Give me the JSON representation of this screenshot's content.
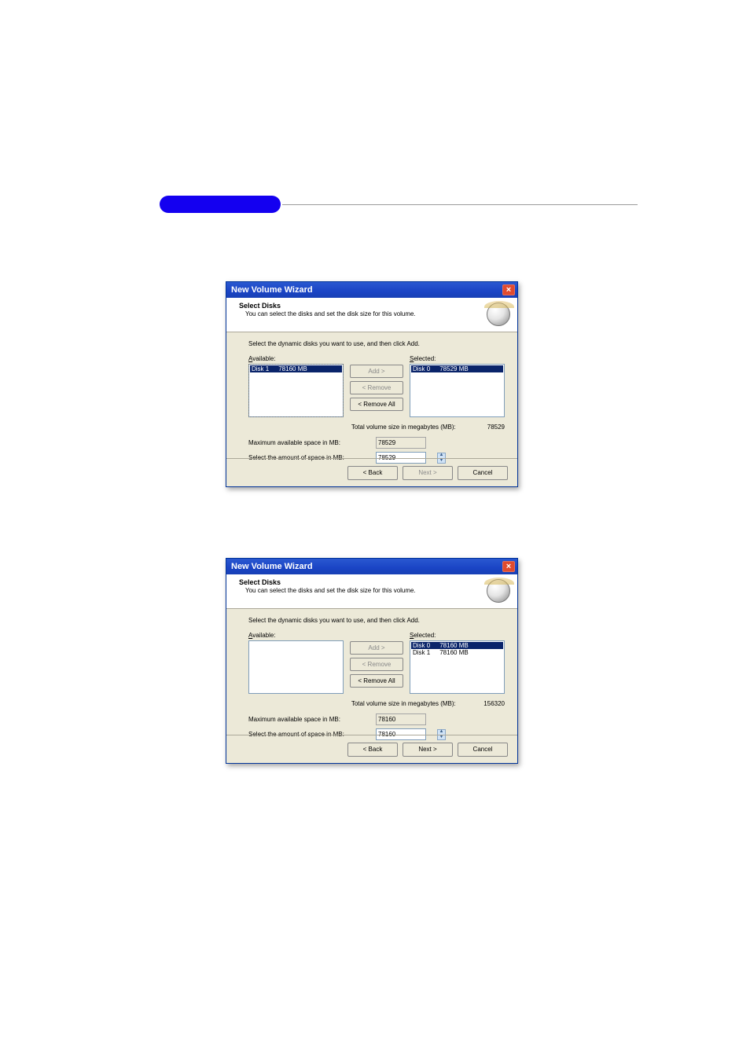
{
  "header_pill_color": "#1400f0",
  "wizard1": {
    "title": "New Volume Wizard",
    "header": {
      "h1": "Select Disks",
      "h2": "You can select the disks and set the disk size for this volume."
    },
    "instruction": "Select the dynamic disks you want to use, and then click Add.",
    "available_label": "Available:",
    "selected_label": "Selected:",
    "available_items": [
      {
        "name": "Disk 1",
        "size": "78160 MB",
        "highlighted": true
      }
    ],
    "selected_items": [
      {
        "name": "Disk 0",
        "size": "78529 MB",
        "highlighted": true
      }
    ],
    "buttons": {
      "add": "Add >",
      "remove": "< Remove",
      "remove_all": "< Remove All"
    },
    "buttons_state": {
      "add": false,
      "remove": false,
      "remove_all": true
    },
    "total_label": "Total volume size in megabytes (MB):",
    "total_value": "78529",
    "max_label": "Maximum available space in MB:",
    "max_value": "78529",
    "amount_label": "Select the amount of space in MB:",
    "amount_value": "78529",
    "footer": {
      "back": "< Back",
      "next": "Next >",
      "cancel": "Cancel"
    },
    "footer_state": {
      "back": true,
      "next": false,
      "cancel": true
    }
  },
  "wizard2": {
    "title": "New Volume Wizard",
    "header": {
      "h1": "Select Disks",
      "h2": "You can select the disks and set the disk size for this volume."
    },
    "instruction": "Select the dynamic disks you want to use, and then click Add.",
    "available_label": "Available:",
    "selected_label": "Selected:",
    "available_items": [],
    "selected_items": [
      {
        "name": "Disk 0",
        "size": "78160 MB",
        "highlighted": true
      },
      {
        "name": "Disk 1",
        "size": "78160 MB",
        "highlighted": false
      }
    ],
    "buttons": {
      "add": "Add >",
      "remove": "< Remove",
      "remove_all": "< Remove All"
    },
    "buttons_state": {
      "add": false,
      "remove": false,
      "remove_all": true
    },
    "total_label": "Total volume size in megabytes (MB):",
    "total_value": "156320",
    "max_label": "Maximum available space in MB:",
    "max_value": "78160",
    "amount_label": "Select the amount of space in MB:",
    "amount_value": "78160",
    "footer": {
      "back": "< Back",
      "next": "Next >",
      "cancel": "Cancel"
    },
    "footer_state": {
      "back": true,
      "next": true,
      "cancel": true
    }
  }
}
